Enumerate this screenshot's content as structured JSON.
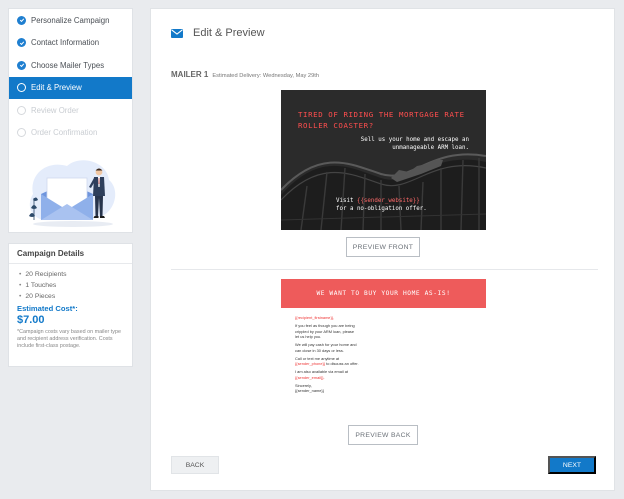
{
  "steps": [
    {
      "label": "Personalize Campaign",
      "state": "done"
    },
    {
      "label": "Contact Information",
      "state": "done"
    },
    {
      "label": "Choose Mailer Types",
      "state": "done"
    },
    {
      "label": "Edit & Preview",
      "state": "active"
    },
    {
      "label": "Review Order",
      "state": "future"
    },
    {
      "label": "Order Confirmation",
      "state": "future"
    }
  ],
  "details": {
    "title": "Campaign Details",
    "items": [
      "20 Recipients",
      "1 Touches",
      "20 Pieces"
    ],
    "estimated_label": "Estimated Cost*:",
    "estimated_value": "$7.00",
    "note": "*Campaign costs vary based on mailer type and recipient address verification. Costs include first-class postage."
  },
  "main": {
    "title": "Edit & Preview",
    "mailer_label": "MAILER 1",
    "delivery": "Estimated Delivery: Wednesday, May 29th",
    "front": {
      "headline_1": "TIRED OF RIDING THE MORTGAGE RATE",
      "headline_2": "ROLLER COASTER?",
      "sub_1": "Sell us your home and escape an",
      "sub_2": "unmanageable ARM loan.",
      "visit_prefix": "Visit",
      "visit_token": "{{sender_website}}",
      "visit_2": "for a no-obligation offer."
    },
    "preview_front_label": "PREVIEW FRONT",
    "back": {
      "banner": "WE WANT TO BUY YOUR HOME AS-IS!",
      "recipient_token": "{{recipient_firstname}},",
      "para1": "If you feel as though you are being crippled by your ARM loan, please let us help you.",
      "para2": "We will pay cash for your home and can close in 30 days or less.",
      "call_text": "Call or text me anytime at",
      "phone_token": "{{sender_phone}}",
      "call_suffix": "to discuss an offer.",
      "email_text": "I am also available via email at",
      "email_token": "{{sender_email}}.",
      "closing": "Sincerely,",
      "name_token": "{{sender_name}}"
    },
    "preview_back_label": "PREVIEW BACK",
    "back_button": "BACK",
    "next_button": "NEXT"
  },
  "colors": {
    "accent": "#1279c9",
    "headline_red": "#ff4e4e",
    "banner_red": "#ee5b5b"
  },
  "icons": {
    "step_done": "check-circle-icon",
    "step_pending": "circle-icon",
    "header": "envelope-icon"
  }
}
